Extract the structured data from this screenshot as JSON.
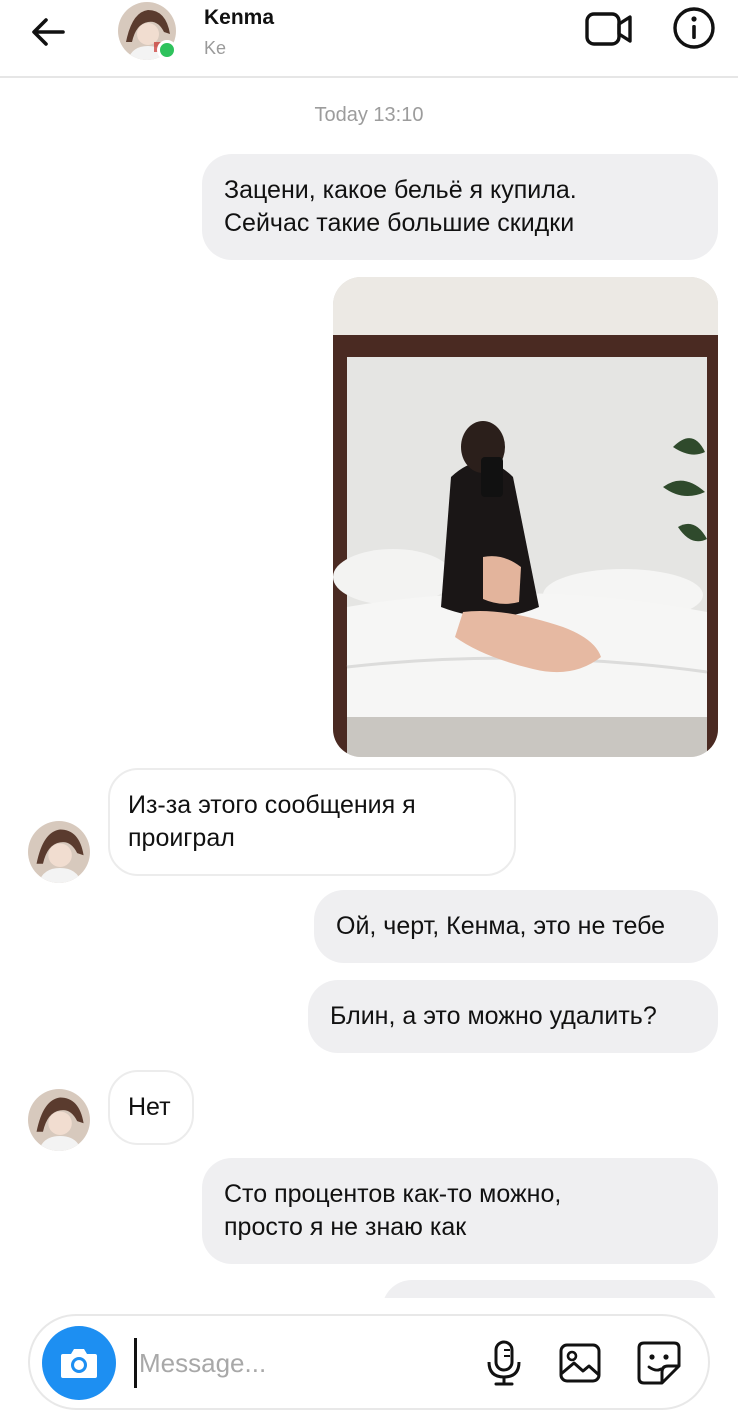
{
  "header": {
    "contact_name": "Kenma",
    "contact_sub": "Ke",
    "online": true
  },
  "chat": {
    "timestamp": "Today 13:10",
    "messages": [
      {
        "direction": "outgoing",
        "lines": [
          "Зацени, какое бельё я купила.",
          "Сейчас  такие большие скидки"
        ]
      },
      {
        "direction": "outgoing",
        "type": "photo",
        "photo_desc": "photo-attachment"
      },
      {
        "direction": "incoming",
        "lines": [
          "Из-за этого сообщения я",
          "проиграл"
        ]
      },
      {
        "direction": "outgoing",
        "lines": [
          "Ой, черт, Кенма, это не тебе"
        ]
      },
      {
        "direction": "outgoing",
        "lines": [
          "Блин, а это можно удалить?"
        ]
      },
      {
        "direction": "incoming",
        "lines": [
          "Нет"
        ]
      },
      {
        "direction": "outgoing",
        "lines": [
          "Сто процентов как-то можно,",
          "просто я не знаю как"
        ]
      }
    ]
  },
  "composer": {
    "placeholder": "Message..."
  },
  "colors": {
    "accent": "#1d8ff2",
    "online": "#2ec25c",
    "outgoing_bubble": "#efeff1"
  },
  "icons": [
    "back-arrow-icon",
    "video-call-icon",
    "info-icon",
    "camera-icon",
    "microphone-icon",
    "gallery-icon",
    "sticker-icon"
  ]
}
